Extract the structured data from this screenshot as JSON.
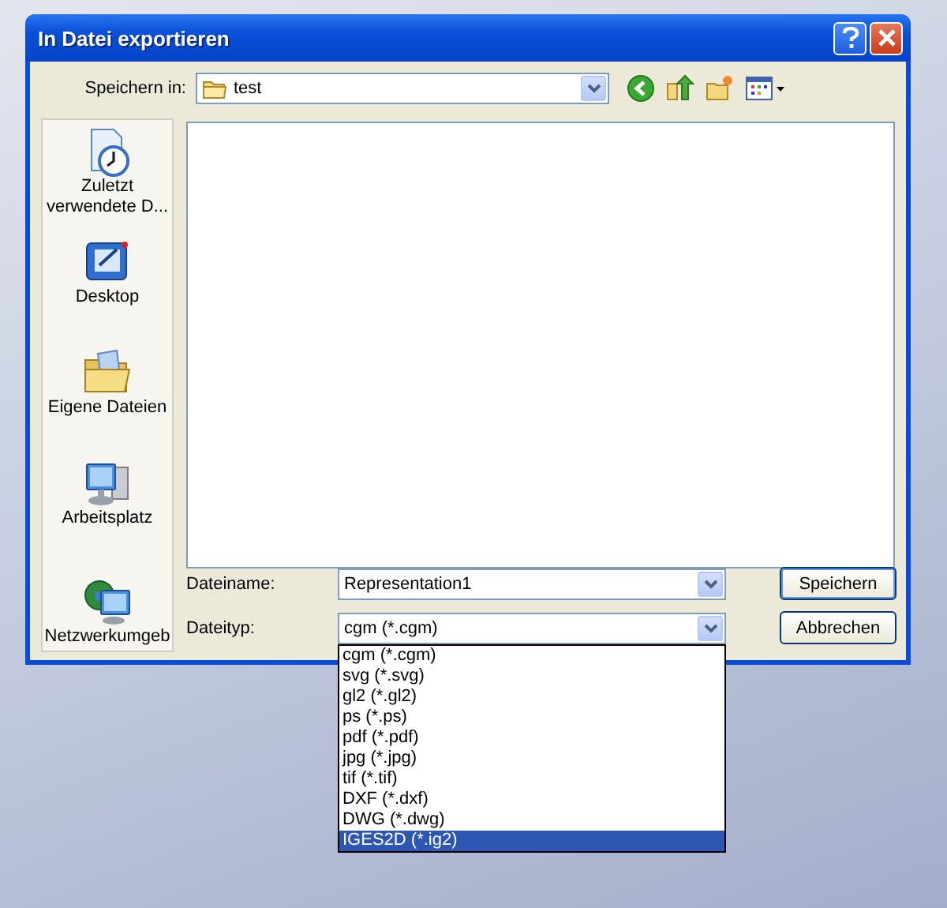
{
  "window": {
    "title": "In Datei exportieren"
  },
  "save_in": {
    "label": "Speichern in:",
    "value": "test"
  },
  "places": [
    {
      "label": "Zuletzt verwendete D...",
      "kind": "recent"
    },
    {
      "label": "Desktop",
      "kind": "desktop"
    },
    {
      "label": "Eigene Dateien",
      "kind": "documents"
    },
    {
      "label": "Arbeitsplatz",
      "kind": "computer"
    },
    {
      "label": "Netzwerkumgeb",
      "kind": "network"
    }
  ],
  "filename": {
    "label": "Dateiname:",
    "value": "Representation1"
  },
  "filetype": {
    "label": "Dateityp:",
    "value": "cgm (*.cgm)",
    "expanded": true
  },
  "filetype_options": [
    {
      "label": "cgm (*.cgm)",
      "selected": false
    },
    {
      "label": "svg (*.svg)",
      "selected": false
    },
    {
      "label": "gl2 (*.gl2)",
      "selected": false
    },
    {
      "label": "ps (*.ps)",
      "selected": false
    },
    {
      "label": "pdf (*.pdf)",
      "selected": false
    },
    {
      "label": "jpg (*.jpg)",
      "selected": false
    },
    {
      "label": "tif (*.tif)",
      "selected": false
    },
    {
      "label": "DXF (*.dxf)",
      "selected": false
    },
    {
      "label": "DWG (*.dwg)",
      "selected": false
    },
    {
      "label": "IGES2D (*.ig2)",
      "selected": true
    }
  ],
  "buttons": [
    {
      "label": "Speichern",
      "kind": "default"
    },
    {
      "label": "Abbrechen",
      "kind": "normal"
    }
  ]
}
